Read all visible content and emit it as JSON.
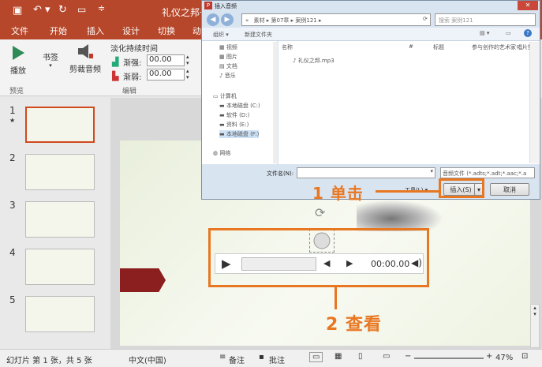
{
  "app": {
    "title": "礼仪之邦一",
    "tabs": [
      "文件",
      "开始",
      "插入",
      "设计",
      "切换",
      "动"
    ]
  },
  "ribbon": {
    "play_label": "播放",
    "bookmark_label": "书签",
    "trim_label": "剪裁音频",
    "fade_group_title": "淡化持续时间",
    "fade_in_label": "渐强:",
    "fade_in_value": "00.00",
    "fade_out_label": "渐弱:",
    "fade_out_value": "00.00",
    "preview_group": "预览",
    "edit_group": "编辑"
  },
  "slides": [
    {
      "num": "1",
      "star": "★"
    },
    {
      "num": "2"
    },
    {
      "num": "3"
    },
    {
      "num": "4"
    },
    {
      "num": "5"
    }
  ],
  "dialog": {
    "title": "插入音频",
    "breadcrumb": [
      "«",
      "素材",
      "第07章",
      "案例121"
    ],
    "search_placeholder": "搜索 案例121",
    "organize_label": "组织 ▾",
    "new_folder_label": "新建文件夹",
    "nav_items": [
      "视频",
      "图片",
      "文档",
      "音乐",
      "计算机",
      "本地磁盘 (C:)",
      "软件 (D:)",
      "资料 (E:)",
      "本地磁盘 (F:)",
      "网络"
    ],
    "col_name": "名称",
    "col_num": "#",
    "col_title": "标题",
    "col_artist": "参与创作的艺术家",
    "col_album": "唱片集",
    "file_name": "礼仪之邦.mp3",
    "filename_label": "文件名(N):",
    "filetype_value": "音频文件 (*.adts;*.adt;*.aac;*.a",
    "tools_label": "工具(L) ▾",
    "insert_label": "插入(S)",
    "cancel_label": "取消"
  },
  "annotations": {
    "step1": "1 单击",
    "step2": "2 查看"
  },
  "player": {
    "time": "00:00.00"
  },
  "status": {
    "slide_info": "幻灯片 第 1 张，共 5 张",
    "language": "中文(中国)",
    "notes_label": "备注",
    "comments_label": "批注",
    "zoom": "47%"
  },
  "colors": {
    "accent": "#b7472a",
    "highlight": "#e87722"
  }
}
